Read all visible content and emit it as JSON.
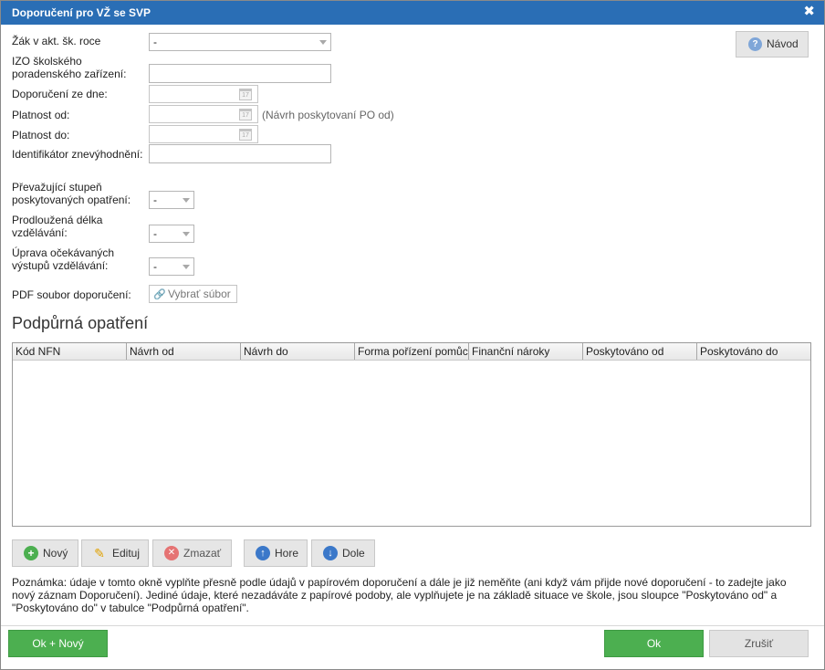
{
  "dialog": {
    "title": "Doporučení pro VŽ se SVP",
    "close_icon": "close-icon"
  },
  "help_button": {
    "label": "Návod",
    "icon": "question-icon"
  },
  "form": {
    "zak_label": "Žák v akt. šk. roce",
    "zak_value": "-",
    "izo_label_line1": "IZO školského",
    "izo_label_line2": "poradenského zařízení:",
    "izo_value": "",
    "doporuceni_ze_dne_label": "Doporučení ze dne:",
    "platnost_od_label": "Platnost od:",
    "platnost_od_hint": "(Návrh poskytovaní PO od)",
    "platnost_do_label": "Platnost do:",
    "identifikator_label": "Identifikátor znevýhodnění:",
    "stupen_label_line1": "Převažující stupeň",
    "stupen_label_line2": "poskytovaných opatření:",
    "stupen_value": "-",
    "delka_label_line1": "Prodloužená délka",
    "delka_label_line2": "vzdělávání:",
    "delka_value": "-",
    "uprava_label_line1": "Úprava očekávaných",
    "uprava_label_line2": "výstupů vzdělávání:",
    "uprava_value": "-",
    "pdf_label": "PDF soubor doporučení:",
    "pdf_button": "Vybrať súbor",
    "calendar_day": "17"
  },
  "support": {
    "title": "Podpůrná opatření",
    "columns": [
      "Kód NFN",
      "Návrh od",
      "Návrh do",
      "Forma pořízení pomůc",
      "Finanční nároky",
      "Poskytováno od",
      "Poskytováno do"
    ],
    "rows": []
  },
  "toolbar": {
    "new_label": "Nový",
    "edit_label": "Edituj",
    "delete_label": "Zmazať",
    "up_label": "Hore",
    "down_label": "Dole"
  },
  "note": {
    "line1": "Poznámka: údaje v tomto okně vyplňte přesně podle údajů v papírovém doporučení a dále je již neměňte (ani když vám přijde nové doporučení - to zadejte jako",
    "line2": "nový záznam Doporučení). Jediné údaje, které nezadáváte z papírové podoby, ale vyplňujete je na základě situace ve škole, jsou sloupce \"Poskytováno od\" a",
    "line3": "\"Poskytováno do\" v tabulce \"Podpůrná opatření\"."
  },
  "footer": {
    "ok_new_label": "Ok + Nový",
    "ok_label": "Ok",
    "cancel_label": "Zrušiť"
  },
  "colors": {
    "titlebar": "#2a6eb5",
    "ok_green": "#4caf50",
    "add_green": "#4caf50",
    "delete_red": "#e57373",
    "arrow_blue": "#3b78c9"
  }
}
